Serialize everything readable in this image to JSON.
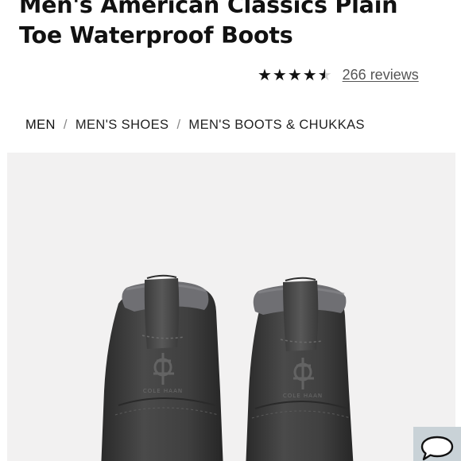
{
  "product": {
    "title": "Men's American Classics Plain Toe Waterproof Boots",
    "rating": {
      "stars": "★★★★★",
      "value": 4.5,
      "max": 5,
      "reviews_label": "266 reviews"
    }
  },
  "breadcrumb": {
    "items": [
      "MEN",
      "MEN'S SHOES",
      "MEN'S BOOTS & CHUKKAS"
    ],
    "separator": "/"
  },
  "hero": {
    "image_icon": "boots-image",
    "background_color": "#f2f1f1"
  },
  "chat": {
    "icon": "chat-bubble-icon",
    "background_color": "#c9d2d7"
  }
}
